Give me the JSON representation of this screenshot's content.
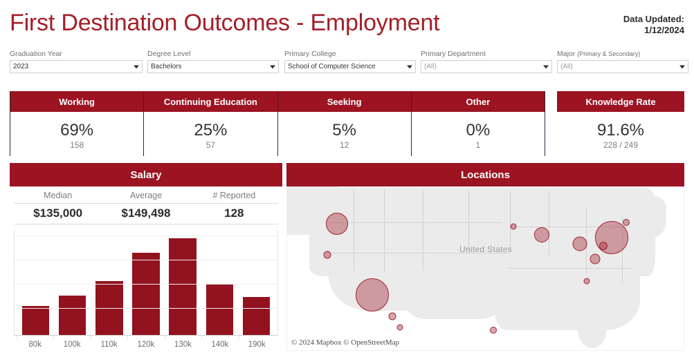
{
  "header": {
    "title": "First Destination Outcomes - Employment",
    "updated_label": "Data Updated:",
    "updated_date": "1/12/2024",
    "title_color": "#A41E28",
    "accent_color": "#9C1322",
    "divider_color": "#1F2B44"
  },
  "filters": [
    {
      "label": "Graduation Year",
      "value": "2023",
      "muted": false,
      "caret": "chevron-down-icon"
    },
    {
      "label": "Degree Level",
      "value": "Bachelors",
      "muted": false,
      "caret": "chevron-down-icon"
    },
    {
      "label": "Primary College",
      "value": "School of Computer Science",
      "muted": false,
      "caret": "chevron-down-icon"
    },
    {
      "label": "Primary Department",
      "value": "(All)",
      "muted": true,
      "caret": "chevron-down-icon"
    },
    {
      "label": "Major ",
      "label_sub": "(Primary & Secondary)",
      "value": "(All)",
      "muted": true,
      "caret": "chevron-down-icon"
    }
  ],
  "kpis": [
    {
      "title": "Working",
      "percent": "69%",
      "count": "158"
    },
    {
      "title": "Continuing Education",
      "percent": "25%",
      "count": "57"
    },
    {
      "title": "Seeking",
      "percent": "5%",
      "count": "12"
    },
    {
      "title": "Other",
      "percent": "0%",
      "count": "1"
    }
  ],
  "knowledge_rate": {
    "title": "Knowledge Rate",
    "percent": "91.6%",
    "count": "228 / 249"
  },
  "salary": {
    "title": "Salary",
    "stats": [
      {
        "label": "Median",
        "value": "$135,000"
      },
      {
        "label": "Average",
        "value": "$149,498"
      },
      {
        "label": "# Reported",
        "value": "128"
      }
    ]
  },
  "chart_data": {
    "type": "bar",
    "title": "Salary",
    "xlabel": "",
    "ylabel": "",
    "categories": [
      "80k",
      "100k",
      "110k",
      "120k",
      "130k",
      "140k",
      "190k"
    ],
    "values": [
      0.3,
      0.41,
      0.56,
      0.85,
      1.0,
      0.53,
      0.39
    ],
    "ylim": [
      0,
      1.0
    ],
    "grid": true,
    "gridline_fractions": [
      0.25,
      0.5,
      0.75,
      1.0
    ],
    "bar_color": "#93121F",
    "legend": "none"
  },
  "locations": {
    "title": "Locations",
    "map_label": "United States",
    "attribution": "© 2024 Mapbox  © OpenStreetMap",
    "bubbles": [
      {
        "x": 12.6,
        "y": 23.0,
        "r": 16
      },
      {
        "x": 10.2,
        "y": 42.0,
        "r": 5.5
      },
      {
        "x": 21.4,
        "y": 66.5,
        "r": 24
      },
      {
        "x": 26.6,
        "y": 79.5,
        "r": 5.5
      },
      {
        "x": 28.5,
        "y": 86.5,
        "r": 4.5
      },
      {
        "x": 57.1,
        "y": 24.5,
        "r": 4.5
      },
      {
        "x": 64.2,
        "y": 29.5,
        "r": 11
      },
      {
        "x": 52.0,
        "y": 88.0,
        "r": 5
      },
      {
        "x": 73.8,
        "y": 35.0,
        "r": 10.5
      },
      {
        "x": 77.6,
        "y": 44.5,
        "r": 7.5
      },
      {
        "x": 81.9,
        "y": 31.5,
        "r": 24
      },
      {
        "x": 79.8,
        "y": 36.5,
        "r": 6
      },
      {
        "x": 85.5,
        "y": 22.0,
        "r": 5
      },
      {
        "x": 75.6,
        "y": 58.0,
        "r": 4.5
      },
      {
        "x": 73.5,
        "y": 104.0,
        "r": 5.5
      }
    ]
  }
}
